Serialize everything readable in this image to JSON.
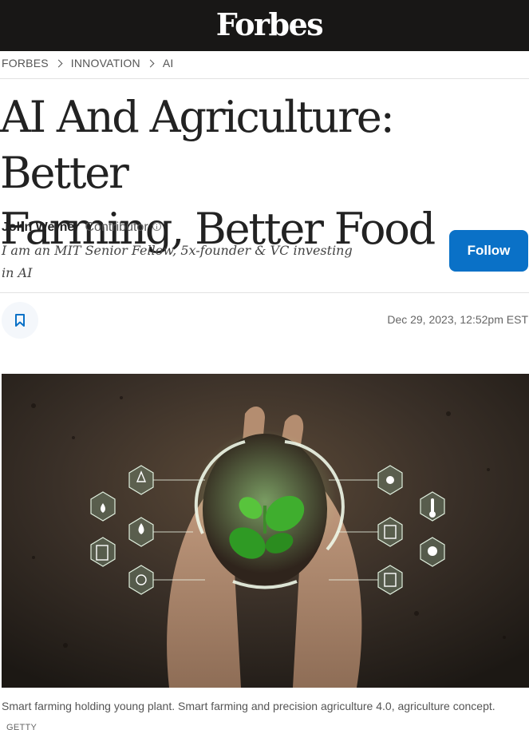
{
  "brand": {
    "logo": "Forbes"
  },
  "breadcrumb": {
    "items": [
      "FORBES",
      "INNOVATION",
      "AI"
    ]
  },
  "article": {
    "title_line1": "AI And Agriculture: Better",
    "title_line2": "Farming, Better Food",
    "author": {
      "name": "John Werner",
      "role": "Contributor",
      "bio": "I am an MIT Senior Fellow, 5x-founder & VC investing in AI"
    },
    "follow_label": "Follow",
    "date": "Dec 29, 2023, 12:52pm EST",
    "image_caption": "Smart farming holding young plant. Smart farming and precision agriculture 4.0, agriculture concept.",
    "image_credit": "GETTY"
  },
  "colors": {
    "header_bg": "#181716",
    "follow_button": "#0a71c7"
  },
  "icons": [
    "chevron-right-icon",
    "info-icon",
    "bookmark-icon"
  ]
}
